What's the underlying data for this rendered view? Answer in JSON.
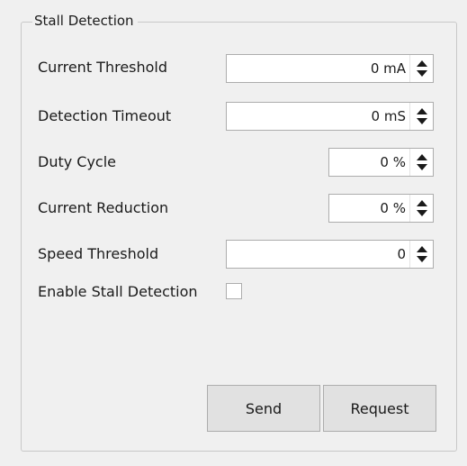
{
  "group": {
    "title": "Stall Detection"
  },
  "fields": {
    "current_threshold": {
      "label": "Current Threshold",
      "value": "0 mA"
    },
    "detection_timeout": {
      "label": "Detection Timeout",
      "value": "0 mS"
    },
    "duty_cycle": {
      "label": "Duty Cycle",
      "value": "0 %"
    },
    "current_reduction": {
      "label": "Current Reduction",
      "value": "0 %"
    },
    "speed_threshold": {
      "label": "Speed Threshold",
      "value": "0"
    }
  },
  "enable": {
    "label": "Enable Stall Detection",
    "checked": false
  },
  "buttons": {
    "send": "Send",
    "request": "Request"
  },
  "icons": {
    "spin_up": "triangle-up",
    "spin_down": "triangle-down"
  }
}
